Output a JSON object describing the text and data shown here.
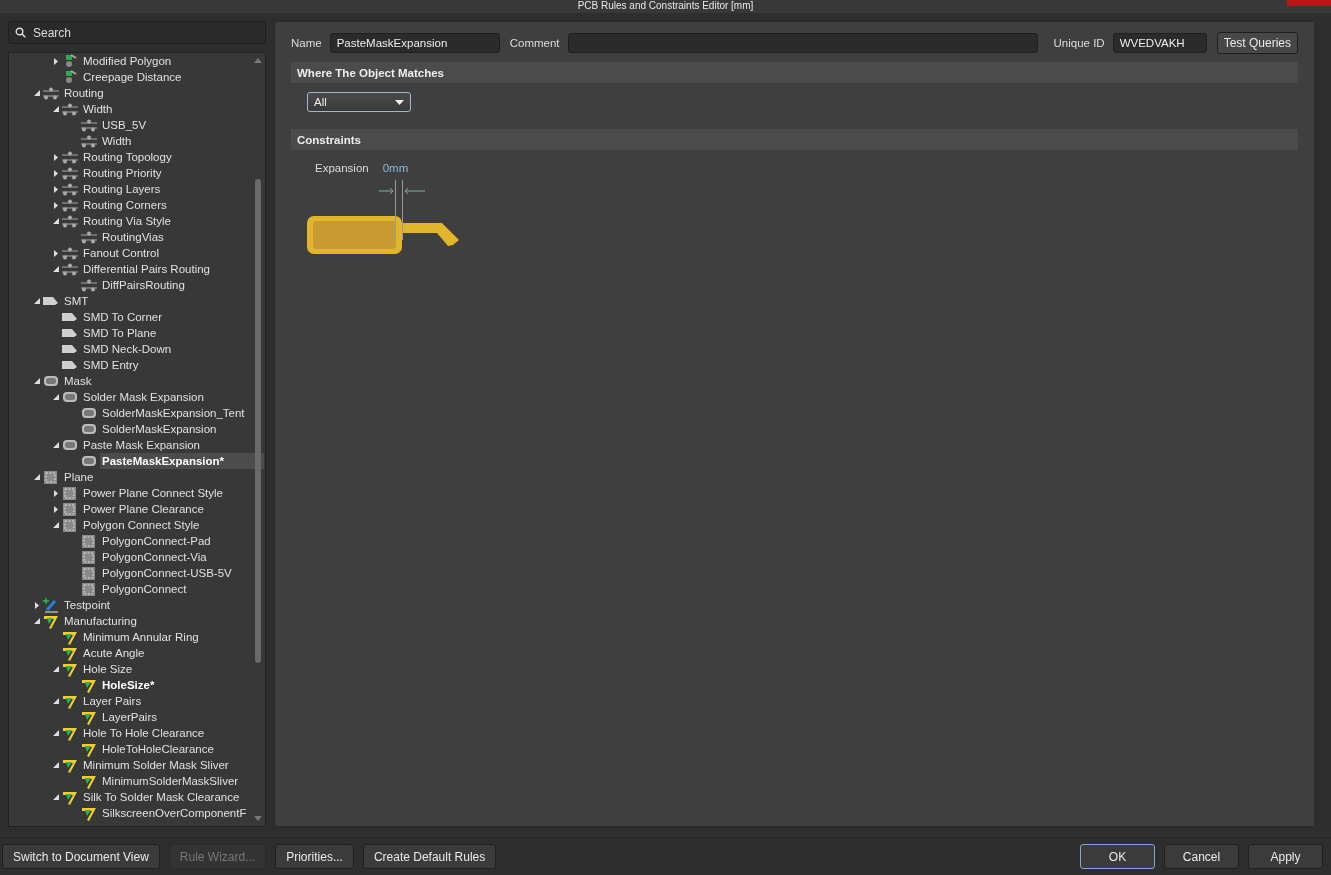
{
  "window": {
    "title": "PCB Rules and Constraints Editor [mm]"
  },
  "search": {
    "placeholder": "Search"
  },
  "tree": [
    {
      "children": [
        {
          "label": "Modified Polygon",
          "kind": "polygon",
          "expanded": false,
          "selected": false,
          "modified": false
        },
        {
          "label": "Creepage Distance",
          "kind": "polygon",
          "selected": false,
          "modified": false
        }
      ]
    },
    {
      "label": "Routing",
      "kind": "routing",
      "expanded": true,
      "selected": false,
      "modified": false,
      "children": [
        {
          "label": "Width",
          "kind": "routing",
          "expanded": true,
          "selected": false,
          "modified": false,
          "children": [
            {
              "label": "USB_5V",
              "kind": "routing",
              "selected": false,
              "modified": false
            },
            {
              "label": "Width",
              "kind": "routing",
              "selected": false,
              "modified": false
            }
          ]
        },
        {
          "label": "Routing Topology",
          "kind": "routing",
          "expanded": false,
          "selected": false,
          "modified": false
        },
        {
          "label": "Routing Priority",
          "kind": "routing",
          "expanded": false,
          "selected": false,
          "modified": false
        },
        {
          "label": "Routing Layers",
          "kind": "routing",
          "expanded": false,
          "selected": false,
          "modified": false
        },
        {
          "label": "Routing Corners",
          "kind": "routing",
          "expanded": false,
          "selected": false,
          "modified": false
        },
        {
          "label": "Routing Via Style",
          "kind": "routing",
          "expanded": true,
          "selected": false,
          "modified": false,
          "children": [
            {
              "label": "RoutingVias",
              "kind": "routing",
              "selected": false,
              "modified": false
            }
          ]
        },
        {
          "label": "Fanout Control",
          "kind": "routing",
          "expanded": false,
          "selected": false,
          "modified": false
        },
        {
          "label": "Differential Pairs Routing",
          "kind": "routing",
          "expanded": true,
          "selected": false,
          "modified": false,
          "children": [
            {
              "label": "DiffPairsRouting",
              "kind": "routing",
              "selected": false,
              "modified": false
            }
          ]
        }
      ]
    },
    {
      "label": "SMT",
      "kind": "smt",
      "expanded": true,
      "selected": false,
      "modified": false,
      "children": [
        {
          "label": "SMD To Corner",
          "kind": "smt",
          "selected": false,
          "modified": false
        },
        {
          "label": "SMD To Plane",
          "kind": "smt",
          "selected": false,
          "modified": false
        },
        {
          "label": "SMD Neck-Down",
          "kind": "smt",
          "selected": false,
          "modified": false
        },
        {
          "label": "SMD Entry",
          "kind": "smt",
          "selected": false,
          "modified": false
        }
      ]
    },
    {
      "label": "Mask",
      "kind": "mask",
      "expanded": true,
      "selected": false,
      "modified": false,
      "children": [
        {
          "label": "Solder Mask Expansion",
          "kind": "mask",
          "expanded": true,
          "selected": false,
          "modified": false,
          "children": [
            {
              "label": "SolderMaskExpansion_Tent",
              "kind": "mask",
              "selected": false,
              "modified": false
            },
            {
              "label": "SolderMaskExpansion",
              "kind": "mask",
              "selected": false,
              "modified": false
            }
          ]
        },
        {
          "label": "Paste Mask Expansion",
          "kind": "mask",
          "expanded": true,
          "selected": false,
          "modified": false,
          "children": [
            {
              "label": "PasteMaskExpansion*",
              "kind": "mask",
              "selected": true,
              "modified": true
            }
          ]
        }
      ]
    },
    {
      "label": "Plane",
      "kind": "plane",
      "expanded": true,
      "selected": false,
      "modified": false,
      "children": [
        {
          "label": "Power Plane Connect Style",
          "kind": "plane",
          "expanded": false,
          "selected": false,
          "modified": false
        },
        {
          "label": "Power Plane Clearance",
          "kind": "plane",
          "expanded": false,
          "selected": false,
          "modified": false
        },
        {
          "label": "Polygon Connect Style",
          "kind": "plane",
          "expanded": true,
          "selected": false,
          "modified": false,
          "children": [
            {
              "label": "PolygonConnect-Pad",
              "kind": "plane",
              "selected": false,
              "modified": false
            },
            {
              "label": "PolygonConnect-Via",
              "kind": "plane",
              "selected": false,
              "modified": false
            },
            {
              "label": "PolygonConnect-USB-5V",
              "kind": "plane",
              "selected": false,
              "modified": false
            },
            {
              "label": "PolygonConnect",
              "kind": "plane",
              "selected": false,
              "modified": false
            }
          ]
        }
      ]
    },
    {
      "label": "Testpoint",
      "kind": "testpoint",
      "expanded": false,
      "selected": false,
      "modified": false
    },
    {
      "label": "Manufacturing",
      "kind": "manufacturing",
      "expanded": true,
      "selected": false,
      "modified": false,
      "children": [
        {
          "label": "Minimum Annular Ring",
          "kind": "manufacturing",
          "selected": false,
          "modified": false
        },
        {
          "label": "Acute Angle",
          "kind": "manufacturing",
          "selected": false,
          "modified": false
        },
        {
          "label": "Hole Size",
          "kind": "manufacturing",
          "expanded": true,
          "selected": false,
          "modified": false,
          "children": [
            {
              "label": "HoleSize*",
              "kind": "manufacturing",
              "selected": false,
              "modified": true
            }
          ]
        },
        {
          "label": "Layer Pairs",
          "kind": "manufacturing",
          "expanded": true,
          "selected": false,
          "modified": false,
          "children": [
            {
              "label": "LayerPairs",
              "kind": "manufacturing",
              "selected": false,
              "modified": false
            }
          ]
        },
        {
          "label": "Hole To Hole Clearance",
          "kind": "manufacturing",
          "expanded": true,
          "selected": false,
          "modified": false,
          "children": [
            {
              "label": "HoleToHoleClearance",
              "kind": "manufacturing",
              "selected": false,
              "modified": false
            }
          ]
        },
        {
          "label": "Minimum Solder Mask Sliver",
          "kind": "manufacturing",
          "expanded": true,
          "selected": false,
          "modified": false,
          "children": [
            {
              "label": "MinimumSolderMaskSliver",
              "kind": "manufacturing",
              "selected": false,
              "modified": false
            }
          ]
        },
        {
          "label": "Silk To Solder Mask Clearance",
          "kind": "manufacturing",
          "expanded": true,
          "selected": false,
          "modified": false,
          "children": [
            {
              "label": "SilkscreenOverComponentF",
              "kind": "manufacturing",
              "selected": false,
              "modified": false
            }
          ]
        }
      ]
    }
  ],
  "rule": {
    "name_label": "Name",
    "name": "PasteMaskExpansion",
    "comment_label": "Comment",
    "unique_id_label": "Unique ID",
    "unique_id": "WVEDVAKH",
    "test_button": "Test Queries"
  },
  "match_section": {
    "title": "Where The Object Matches",
    "scope": "All"
  },
  "constraints_section": {
    "title": "Constraints",
    "expansion_label": "Expansion",
    "expansion_value": "0mm"
  },
  "left_buttons": [
    {
      "label": "Switch to Document View",
      "disabled": false,
      "focused": false
    },
    {
      "label": "Rule Wizard...",
      "disabled": true,
      "focused": false
    },
    {
      "label": "Priorities...",
      "disabled": false,
      "focused": false
    },
    {
      "label": "Create Default Rules",
      "disabled": false,
      "focused": false
    }
  ],
  "right_buttons": [
    {
      "label": "OK",
      "disabled": false,
      "focused": true
    },
    {
      "label": "Cancel",
      "disabled": false,
      "focused": false
    },
    {
      "label": "Apply",
      "disabled": false,
      "focused": false
    }
  ]
}
